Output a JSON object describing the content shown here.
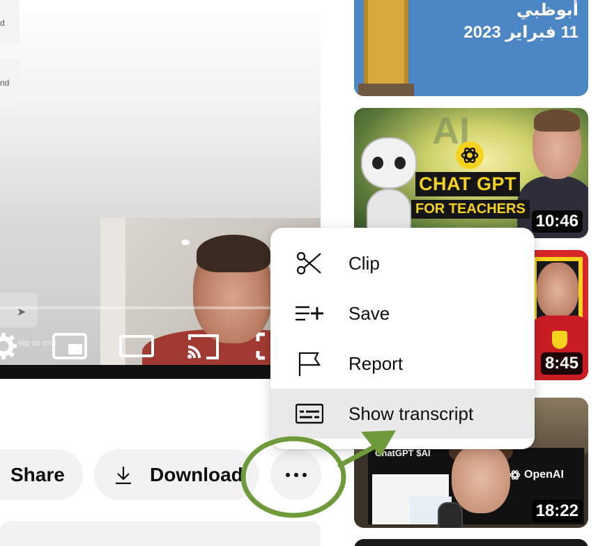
{
  "player": {
    "help_text": "elp us imp",
    "chat_cards": [
      {
        "text": "d"
      },
      {
        "text": "nd"
      }
    ]
  },
  "actions": {
    "share_label": "Share",
    "download_label": "Download"
  },
  "menu": {
    "items": [
      {
        "label": "Clip",
        "icon": "scissors-icon"
      },
      {
        "label": "Save",
        "icon": "playlist-add-icon"
      },
      {
        "label": "Report",
        "icon": "flag-icon"
      },
      {
        "label": "Show transcript",
        "icon": "transcript-icon",
        "highlighted": true
      }
    ]
  },
  "recommendations": [
    {
      "line1": "أبوظبي",
      "line2": "11 فبراير 2023"
    },
    {
      "ai": "AI",
      "title": "CHAT GPT",
      "subtitle": "FOR TEACHERS",
      "duration": "10:46"
    },
    {
      "duration": "8:45"
    },
    {
      "tag": "ChatGPT $AI",
      "brand": "OpenAI",
      "duration": "18:22"
    }
  ],
  "annotation": {
    "color": "#6f9a3a"
  }
}
